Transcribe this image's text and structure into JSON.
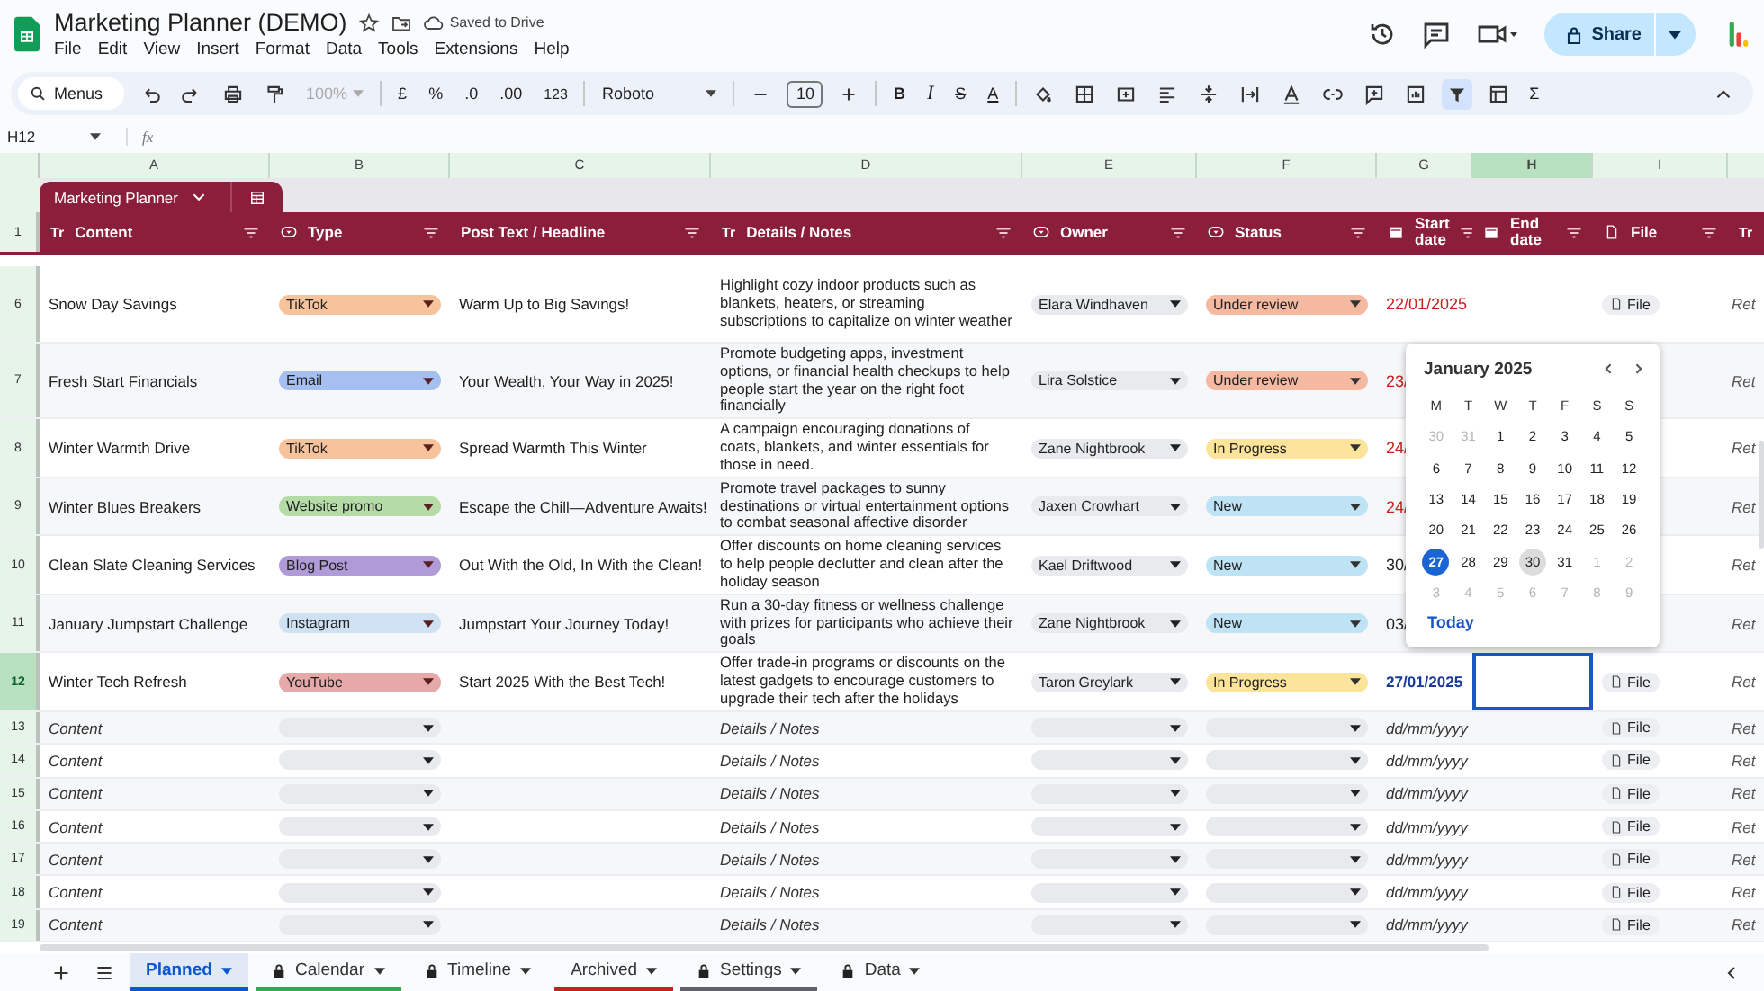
{
  "app": {
    "title": "Marketing Planner (DEMO)",
    "save_status": "Saved to Drive",
    "menu": [
      "File",
      "Edit",
      "View",
      "Insert",
      "Format",
      "Data",
      "Tools",
      "Extensions",
      "Help"
    ],
    "share_label": "Share"
  },
  "toolbar": {
    "search_label": "Menus",
    "zoom": "100%",
    "currency": "£",
    "percent": "%",
    "dec_less": ".0",
    "dec_more": ".00",
    "number_format": "123",
    "font": "Roboto",
    "font_size": "10",
    "bold": "B",
    "italic": "I",
    "strike": "S",
    "text_color": "A",
    "sum": "Σ",
    "filter_on": true
  },
  "formula_bar": {
    "cell_ref": "H12",
    "fx": "fx"
  },
  "column_letters": [
    {
      "label": "A",
      "selected": false
    },
    {
      "label": "B",
      "selected": false
    },
    {
      "label": "C",
      "selected": false
    },
    {
      "label": "D",
      "selected": false
    },
    {
      "label": "E",
      "selected": false
    },
    {
      "label": "F",
      "selected": false
    },
    {
      "label": "G",
      "selected": false
    },
    {
      "label": "H",
      "selected": true
    },
    {
      "label": "I",
      "selected": false
    }
  ],
  "table": {
    "name": "Marketing Planner",
    "header_row": "1",
    "columns": [
      {
        "label": "Content",
        "kind": "text",
        "icon": "Tr"
      },
      {
        "label": "Type",
        "kind": "dropdown"
      },
      {
        "label": "Post Text / Headline",
        "kind": "plain"
      },
      {
        "label": "Details / Notes",
        "kind": "text",
        "icon": "Tr"
      },
      {
        "label": "Owner",
        "kind": "dropdown"
      },
      {
        "label": "Status",
        "kind": "dropdown"
      },
      {
        "label": "Start date",
        "kind": "date"
      },
      {
        "label": "End date",
        "kind": "date"
      },
      {
        "label": "File",
        "kind": "file"
      },
      {
        "kind": "text",
        "icon": "Tr"
      }
    ],
    "rows": [
      {
        "kind": "filled",
        "row": "6",
        "selected": false,
        "content": "Snow Day Savings",
        "type": {
          "label": "TikTok",
          "color": "#f7c39c"
        },
        "headline": "Warm Up to Big Savings!",
        "details": "Highlight cozy indoor products such as blankets, heaters, or streaming subscriptions to capitalize on winter weather",
        "owner": "Elara Windhaven",
        "status": {
          "label": "Under review",
          "color": "#f4b9a0"
        },
        "start": {
          "text": "22/01/2025",
          "overdue": true,
          "current": false
        },
        "file": "File",
        "col_j": "Ret"
      },
      {
        "kind": "filled",
        "row": "7",
        "selected": false,
        "content": "Fresh Start Financials",
        "type": {
          "label": "Email",
          "color": "#a4bff0"
        },
        "headline": "Your Wealth, Your Way in 2025!",
        "details": "Promote budgeting apps, investment options, or financial health checkups to help people start the year on the right foot financially",
        "owner": "Lira Solstice",
        "status": {
          "label": "Under review",
          "color": "#f4b9a0"
        },
        "start": {
          "text": "23/",
          "overdue": true,
          "current": false
        },
        "col_j": "Ret"
      },
      {
        "kind": "filled",
        "row": "8",
        "selected": false,
        "content": "Winter Warmth Drive",
        "type": {
          "label": "TikTok",
          "color": "#f7c39c"
        },
        "headline": "Spread Warmth This Winter",
        "details": "A campaign encouraging donations of coats, blankets, and winter essentials for those in need.",
        "owner": "Zane Nightbrook",
        "status": {
          "label": "In Progress",
          "color": "#fde49b"
        },
        "start": {
          "text": "24/",
          "overdue": true,
          "current": false
        },
        "col_j": "Ret"
      },
      {
        "kind": "filled",
        "row": "9",
        "selected": false,
        "content": "Winter Blues Breakers",
        "type": {
          "label": "Website promo",
          "color": "#b5dca7"
        },
        "headline": "Escape the Chill—Adventure Awaits!",
        "details": "Promote travel packages to sunny destinations or virtual entertainment options to combat seasonal affective disorder",
        "owner": "Jaxen Crowhart",
        "status": {
          "label": "New",
          "color": "#bde3f5"
        },
        "start": {
          "text": "24/",
          "overdue": true,
          "current": false
        },
        "col_j": "Ret"
      },
      {
        "kind": "filled",
        "row": "10",
        "selected": false,
        "content": "Clean Slate Cleaning Services",
        "type": {
          "label": "Blog Post",
          "color": "#b09bd8"
        },
        "headline": "Out With the Old, In With the Clean!",
        "details": "Offer discounts on home cleaning services to help people declutter and clean after the holiday season",
        "owner": "Kael Driftwood",
        "status": {
          "label": "New",
          "color": "#bde3f5"
        },
        "start": {
          "text": "30/",
          "overdue": false,
          "current": false
        },
        "col_j": "Ret"
      },
      {
        "kind": "filled",
        "row": "11",
        "selected": false,
        "content": "January Jumpstart Challenge",
        "type": {
          "label": "Instagram",
          "color": "#cfe2f3"
        },
        "headline": "Jumpstart Your Journey Today!",
        "details": "Run a 30-day fitness or wellness challenge with prizes for participants who achieve their goals",
        "owner": "Zane Nightbrook",
        "status": {
          "label": "New",
          "color": "#bde3f5"
        },
        "start": {
          "text": "03/",
          "overdue": false,
          "current": false
        },
        "col_j": "Ret"
      },
      {
        "kind": "filled",
        "row": "12",
        "selected": true,
        "content": "Winter Tech Refresh",
        "type": {
          "label": "YouTube",
          "color": "#e6a8a8"
        },
        "headline": "Start 2025 With the Best Tech!",
        "details": "Offer trade-in programs or discounts on the latest gadgets to encourage customers to upgrade their tech after the holidays",
        "owner": "Taron Greylark",
        "status": {
          "label": "In Progress",
          "color": "#fde49b"
        },
        "start": {
          "text": "27/01/2025",
          "overdue": false,
          "current": true
        },
        "file": "File",
        "col_j": "Ret"
      },
      {
        "kind": "empty",
        "row": "13",
        "selected": false,
        "content": "Content",
        "details": "Details / Notes",
        "start": {
          "text": "dd/mm/yyyy"
        },
        "file": "File",
        "col_j": "Ret"
      },
      {
        "kind": "empty",
        "row": "14",
        "selected": false,
        "content": "Content",
        "details": "Details / Notes",
        "start": {
          "text": "dd/mm/yyyy"
        },
        "file": "File",
        "col_j": "Ret"
      },
      {
        "kind": "empty",
        "row": "15",
        "selected": false,
        "content": "Content",
        "details": "Details / Notes",
        "start": {
          "text": "dd/mm/yyyy"
        },
        "file": "File",
        "col_j": "Ret"
      },
      {
        "kind": "empty",
        "row": "16",
        "selected": false,
        "content": "Content",
        "details": "Details / Notes",
        "start": {
          "text": "dd/mm/yyyy"
        },
        "file": "File",
        "col_j": "Ret"
      },
      {
        "kind": "empty",
        "row": "17",
        "selected": false,
        "content": "Content",
        "details": "Details / Notes",
        "start": {
          "text": "dd/mm/yyyy"
        },
        "file": "File",
        "col_j": "Ret"
      },
      {
        "kind": "empty",
        "row": "18",
        "selected": false,
        "content": "Content",
        "details": "Details / Notes",
        "start": {
          "text": "dd/mm/yyyy"
        },
        "file": "File",
        "col_j": "Ret"
      },
      {
        "kind": "empty",
        "row": "19",
        "selected": false,
        "content": "Content",
        "details": "Details / Notes",
        "start": {
          "text": "dd/mm/yyyy"
        },
        "file": "File",
        "col_j": "Ret"
      }
    ]
  },
  "date_picker": {
    "title": "January 2025",
    "weekdays": [
      "M",
      "T",
      "W",
      "T",
      "F",
      "S",
      "S"
    ],
    "today_label": "Today",
    "days": [
      {
        "label": "30",
        "muted": true,
        "selected": false,
        "hovered": false
      },
      {
        "label": "31",
        "muted": true,
        "selected": false,
        "hovered": false
      },
      {
        "label": "1",
        "muted": false,
        "selected": false,
        "hovered": false
      },
      {
        "label": "2",
        "muted": false,
        "selected": false,
        "hovered": false
      },
      {
        "label": "3",
        "muted": false,
        "selected": false,
        "hovered": false
      },
      {
        "label": "4",
        "muted": false,
        "selected": false,
        "hovered": false
      },
      {
        "label": "5",
        "muted": false,
        "selected": false,
        "hovered": false
      },
      {
        "label": "6",
        "muted": false,
        "selected": false,
        "hovered": false
      },
      {
        "label": "7",
        "muted": false,
        "selected": false,
        "hovered": false
      },
      {
        "label": "8",
        "muted": false,
        "selected": false,
        "hovered": false
      },
      {
        "label": "9",
        "muted": false,
        "selected": false,
        "hovered": false
      },
      {
        "label": "10",
        "muted": false,
        "selected": false,
        "hovered": false
      },
      {
        "label": "11",
        "muted": false,
        "selected": false,
        "hovered": false
      },
      {
        "label": "12",
        "muted": false,
        "selected": false,
        "hovered": false
      },
      {
        "label": "13",
        "muted": false,
        "selected": false,
        "hovered": false
      },
      {
        "label": "14",
        "muted": false,
        "selected": false,
        "hovered": false
      },
      {
        "label": "15",
        "muted": false,
        "selected": false,
        "hovered": false
      },
      {
        "label": "16",
        "muted": false,
        "selected": false,
        "hovered": false
      },
      {
        "label": "17",
        "muted": false,
        "selected": false,
        "hovered": false
      },
      {
        "label": "18",
        "muted": false,
        "selected": false,
        "hovered": false
      },
      {
        "label": "19",
        "muted": false,
        "selected": false,
        "hovered": false
      },
      {
        "label": "20",
        "muted": false,
        "selected": false,
        "hovered": false
      },
      {
        "label": "21",
        "muted": false,
        "selected": false,
        "hovered": false
      },
      {
        "label": "22",
        "muted": false,
        "selected": false,
        "hovered": false
      },
      {
        "label": "23",
        "muted": false,
        "selected": false,
        "hovered": false
      },
      {
        "label": "24",
        "muted": false,
        "selected": false,
        "hovered": false
      },
      {
        "label": "25",
        "muted": false,
        "selected": false,
        "hovered": false
      },
      {
        "label": "26",
        "muted": false,
        "selected": false,
        "hovered": false
      },
      {
        "label": "27",
        "muted": false,
        "selected": true,
        "hovered": false
      },
      {
        "label": "28",
        "muted": false,
        "selected": false,
        "hovered": false
      },
      {
        "label": "29",
        "muted": false,
        "selected": false,
        "hovered": false
      },
      {
        "label": "30",
        "muted": false,
        "selected": false,
        "hovered": true
      },
      {
        "label": "31",
        "muted": false,
        "selected": false,
        "hovered": false
      },
      {
        "label": "1",
        "muted": true,
        "selected": false,
        "hovered": false
      },
      {
        "label": "2",
        "muted": true,
        "selected": false,
        "hovered": false
      },
      {
        "label": "3",
        "muted": true,
        "selected": false,
        "hovered": false
      },
      {
        "label": "4",
        "muted": true,
        "selected": false,
        "hovered": false
      },
      {
        "label": "5",
        "muted": true,
        "selected": false,
        "hovered": false
      },
      {
        "label": "6",
        "muted": true,
        "selected": false,
        "hovered": false
      },
      {
        "label": "7",
        "muted": true,
        "selected": false,
        "hovered": false
      },
      {
        "label": "8",
        "muted": true,
        "selected": false,
        "hovered": false
      },
      {
        "label": "9",
        "muted": true,
        "selected": false,
        "hovered": false
      }
    ]
  },
  "sheet_tabs": [
    {
      "label": "Planned",
      "selected": true,
      "locked": false
    },
    {
      "label": "Calendar",
      "selected": false,
      "locked": true,
      "color": "#34a853"
    },
    {
      "label": "Timeline",
      "selected": false,
      "locked": true
    },
    {
      "label": "Archived",
      "selected": false,
      "locked": false,
      "color": "#c5221f"
    },
    {
      "label": "Settings",
      "selected": false,
      "locked": true,
      "color": "#5f6368"
    },
    {
      "label": "Data",
      "selected": false,
      "locked": true
    }
  ]
}
